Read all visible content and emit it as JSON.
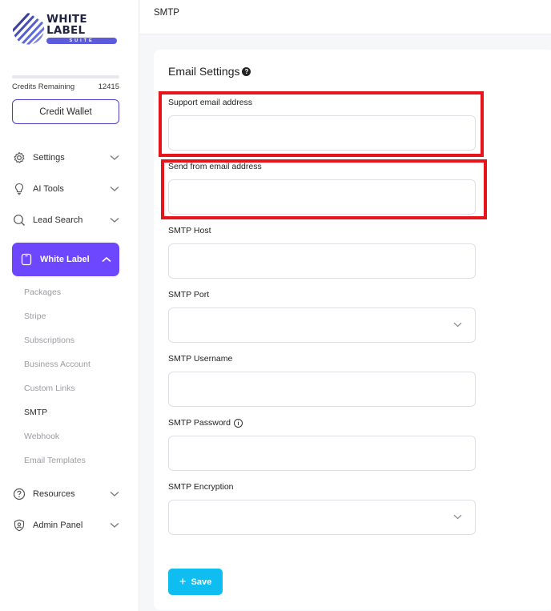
{
  "brand": {
    "name": "WHITE LABEL",
    "tagline": "SUITE"
  },
  "credits": {
    "label": "Credits Remaining",
    "value": "12415",
    "button_label": "Credit Wallet"
  },
  "nav": {
    "settings": "Settings",
    "ai_tools": "AI Tools",
    "lead_search": "Lead Search",
    "white_label": "White Label",
    "resources": "Resources",
    "admin_panel": "Admin Panel"
  },
  "white_label_sub": {
    "packages": "Packages",
    "stripe": "Stripe",
    "subscriptions": "Subscriptions",
    "business_account": "Business Account",
    "custom_links": "Custom Links",
    "smtp": "SMTP",
    "webhook": "Webhook",
    "email_templates": "Email Templates"
  },
  "header": {
    "title": "SMTP"
  },
  "form": {
    "title": "Email Settings",
    "support_email_label": "Support email address",
    "send_from_label": "Send from email address",
    "smtp_host_label": "SMTP Host",
    "smtp_port_label": "SMTP Port",
    "smtp_username_label": "SMTP Username",
    "smtp_password_label": "SMTP Password",
    "smtp_encryption_label": "SMTP Encryption",
    "save_label": "Save"
  },
  "colors": {
    "accent": "#6c47ff",
    "save": "#0fbdf0",
    "highlight": "#e8141b"
  },
  "icons": [
    "gear-icon",
    "bulb-icon",
    "search-icon",
    "tablet-icon",
    "help-icon",
    "shield-user-icon",
    "chevron-down-icon",
    "chevron-up-icon",
    "info-icon",
    "plus-icon"
  ]
}
